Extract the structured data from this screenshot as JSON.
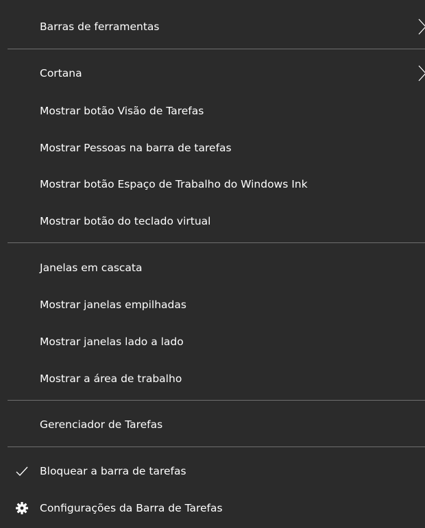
{
  "menu": {
    "items": [
      {
        "label": "Barras de ferramentas",
        "icon": "chevron-right-icon"
      },
      {
        "label": "Cortana",
        "icon": "chevron-right-icon"
      },
      {
        "label": "Mostrar botão Visão de Tarefas"
      },
      {
        "label": "Mostrar Pessoas na barra de tarefas"
      },
      {
        "label": "Mostrar botão Espaço de Trabalho do Windows Ink"
      },
      {
        "label": "Mostrar botão do teclado virtual"
      },
      {
        "label": "Janelas em cascata"
      },
      {
        "label": "Mostrar janelas empilhadas"
      },
      {
        "label": "Mostrar janelas lado a lado"
      },
      {
        "label": "Mostrar a área de trabalho"
      },
      {
        "label": "Gerenciador de Tarefas"
      },
      {
        "label": "Bloquear a barra de tarefas",
        "icon": "checkmark-icon",
        "checked": true
      },
      {
        "label": "Configurações da Barra de Tarefas",
        "icon": "gear-icon"
      }
    ]
  },
  "colors": {
    "background": "#2b2b2b",
    "text": "#ffffff",
    "separator": "#6f6f6f"
  }
}
